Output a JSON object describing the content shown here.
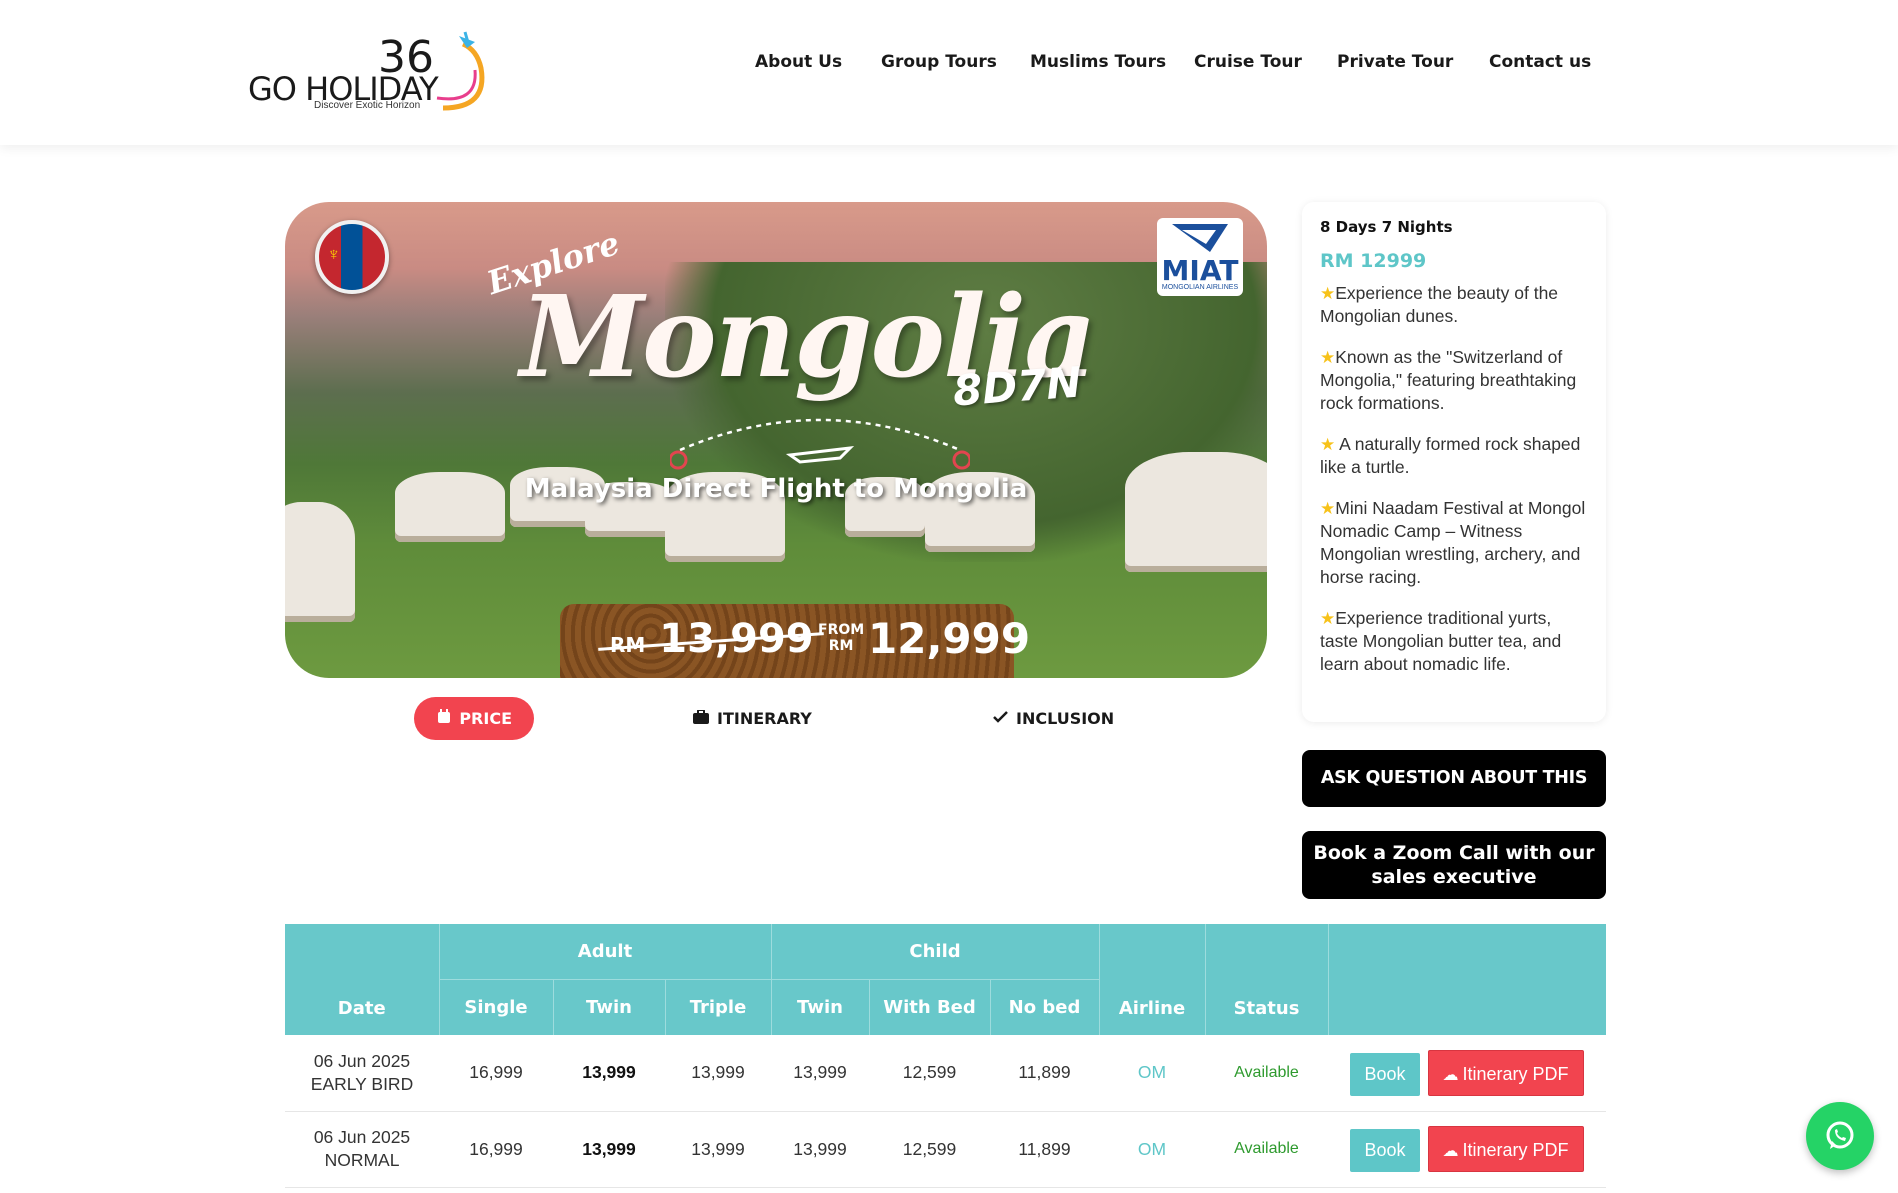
{
  "brand": {
    "name": "GO HOLIDAY",
    "number": "36",
    "tagline": "Discover Exotic Horizon"
  },
  "nav": {
    "items": [
      "About Us",
      "Group Tours",
      "Muslims Tours",
      "Cruise Tour",
      "Private Tour",
      "Contact us"
    ]
  },
  "banner": {
    "explore": "Explore",
    "title": "Mongolia",
    "duration": "8D7N",
    "route": "Malaysia Direct Flight to Mongolia",
    "airline_logo": "MIAT",
    "airline_logo_sub": "MONGOLIAN AIRLINES",
    "old_price_currency": "RM",
    "old_price": "13,999",
    "from_label": "FROM",
    "from_currency": "RM",
    "new_price": "12,999"
  },
  "tabs": {
    "price": "PRICE",
    "itinerary": "ITINERARY",
    "inclusion": "INCLUSION"
  },
  "tour": {
    "duration": "8 Days 7 Nights",
    "price": "RM 12999",
    "highlights": [
      "Experience the beauty of the Mongolian dunes.",
      "Known as the \"Switzerland of Mongolia,\" featuring breathtaking rock formations.",
      " A naturally formed rock shaped like a turtle.",
      "Mini Naadam Festival at Mongol Nomadic Camp – Witness Mongolian wrestling, archery, and horse racing.",
      "Experience traditional yurts, taste Mongolian butter tea, and learn about nomadic life."
    ]
  },
  "buttons": {
    "ask": "ASK QUESTION ABOUT THIS TOUR",
    "zoom": "Book a Zoom Call with our sales executive"
  },
  "table": {
    "headers": {
      "date": "Date",
      "adult": "Adult",
      "child": "Child",
      "single": "Single",
      "adult_twin": "Twin",
      "triple": "Triple",
      "child_twin": "Twin",
      "with_bed": "With Bed",
      "no_bed": "No bed",
      "airline": "Airline",
      "status": "Status"
    },
    "rows": [
      {
        "date": "06 Jun 2025",
        "type": "EARLY BIRD",
        "single": "16,999",
        "twin": "13,999",
        "triple": "13,999",
        "child_twin": "13,999",
        "with_bed": "12,599",
        "no_bed": "11,899",
        "airline": "OM",
        "status": "Available",
        "book": "Book",
        "pdf": "Itinerary PDF"
      },
      {
        "date": "06 Jun 2025",
        "type": "NORMAL",
        "single": "16,999",
        "twin": "13,999",
        "triple": "13,999",
        "child_twin": "13,999",
        "with_bed": "12,599",
        "no_bed": "11,899",
        "airline": "OM",
        "status": "Available",
        "book": "Book",
        "pdf": "Itinerary PDF"
      }
    ]
  },
  "colors": {
    "accent": "#68c8ca",
    "primary_red": "#f2444f",
    "whatsapp": "#25d366"
  },
  "icons": {
    "calendar": "calendar-icon",
    "briefcase": "briefcase-icon",
    "check": "check-icon",
    "star": "star-icon",
    "cloud_download": "cloud-download-icon",
    "whatsapp": "whatsapp-icon"
  }
}
